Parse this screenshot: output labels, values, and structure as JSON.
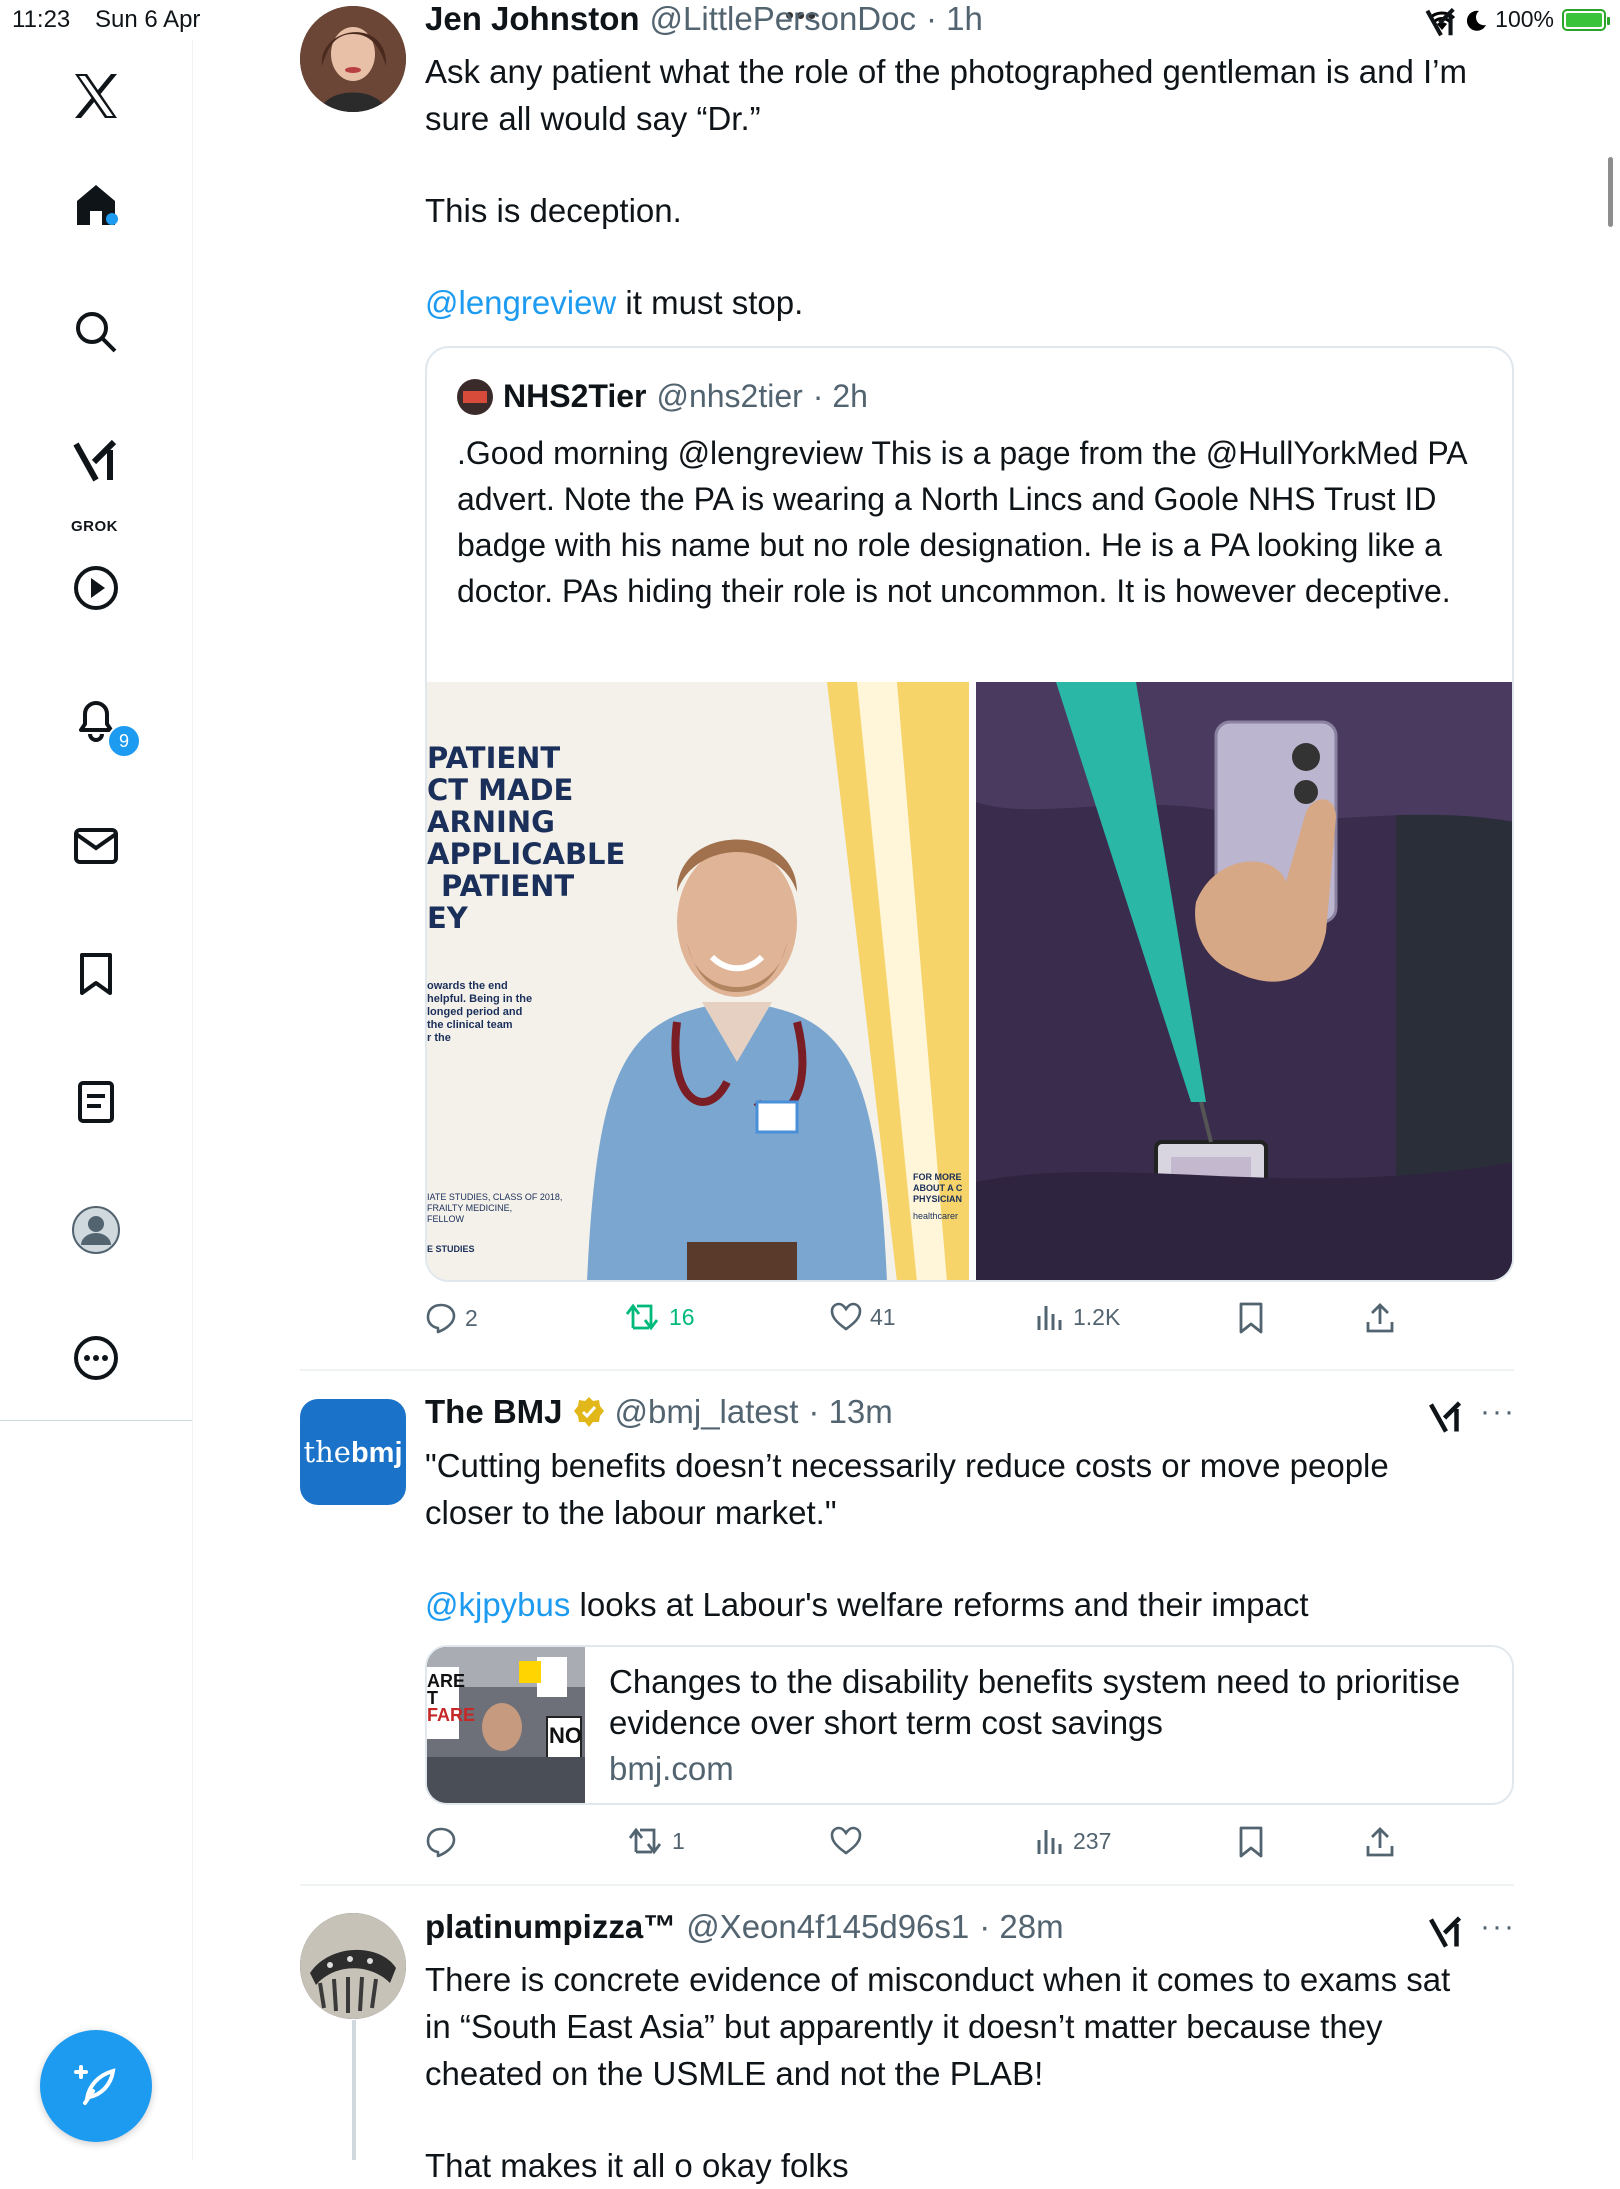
{
  "status_bar": {
    "time": "11:23",
    "date": "Sun 6 Apr",
    "battery": "100%"
  },
  "sidebar": {
    "items": [
      {
        "name": "x-logo"
      },
      {
        "name": "home"
      },
      {
        "name": "search"
      },
      {
        "name": "grok",
        "label": "GROK"
      },
      {
        "name": "video"
      },
      {
        "name": "notifications",
        "badge": "9"
      },
      {
        "name": "messages"
      },
      {
        "name": "bookmarks"
      },
      {
        "name": "lists"
      },
      {
        "name": "profile"
      },
      {
        "name": "more"
      }
    ]
  },
  "tweets": [
    {
      "name": "Jen Johnston",
      "handle": "@LittlePersonDoc",
      "time": "· 1h",
      "line1": "Ask any patient what the role of the photographed gentleman is and I’m",
      "line2": "sure all would say “Dr.”",
      "line3": "This is deception.",
      "mention": "@lengreview",
      "line4": " it must stop.",
      "quote": {
        "name": "NHS2Tier",
        "handle": "@nhs2tier",
        "time": "· 2h",
        "text": ".Good morning @lengreview This is a page from the @HullYorkMed PA advert. Note the PA is wearing a North Lincs and Goole NHS Trust ID badge with his name but no role designation. He is a PA looking like a doctor. PAs hiding their role is not uncommon. It is however deceptive.",
        "image_text": {
          "lines": [
            "PATIENT",
            "CT MADE",
            "ARNING",
            "APPLICABLE",
            "PATIENT",
            "EY"
          ],
          "small": [
            "owards the end",
            "helpful. Being in the",
            "longed period and",
            "the clinical team",
            "r the"
          ],
          "caption": [
            "IATE STUDIES, CLASS OF 2018,",
            "FRAILTY MEDICINE,",
            "FELLOW"
          ],
          "studies": "E STUDIES",
          "more": [
            "FOR MORE",
            "ABOUT A C",
            "PHYSICIAN"
          ],
          "site": "healthcarer"
        }
      },
      "replies": "2",
      "reposts": "16",
      "likes": "41",
      "views": "1.2K"
    },
    {
      "name": "The BMJ",
      "handle": "@bmj_latest",
      "time": "· 13m",
      "avatar_text_a": "the",
      "avatar_text_b": "bmj",
      "line1": "\"Cutting benefits doesn’t necessarily reduce costs or move people",
      "line2": "closer to the labour market.\"",
      "mention": "@kjpybus",
      "line3": " looks at Labour's welfare reforms and their impact",
      "link": {
        "title": "Changes to the disability benefits system need to prioritise evidence over short term cost savings",
        "domain": "bmj.com",
        "sign_text": [
          "ARE",
          "T",
          "FARE",
          "NO"
        ]
      },
      "replies": "",
      "reposts": "1",
      "likes": "",
      "views": "237"
    },
    {
      "name": "platinumpizza™",
      "handle": "@Xeon4f145d96s1",
      "time": "· 28m",
      "line1": "There is concrete evidence of misconduct when it comes to exams sat",
      "line2": "in “South East Asia” but apparently it doesn’t matter because they",
      "line3": "cheated on the USMLE and not the PLAB!",
      "line4": "That makes it all o  okay folks"
    }
  ],
  "colors": {
    "accent": "#1d9bf0",
    "repost_green": "#00ba7c",
    "text_secondary": "#536471",
    "bmj_blue": "#1a73c8"
  }
}
